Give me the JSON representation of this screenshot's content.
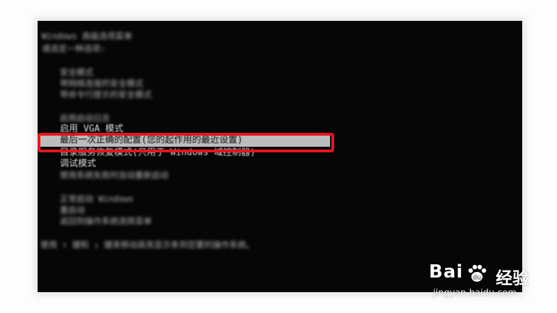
{
  "boot_menu": {
    "header_lines": [
      "Windows 高级选项菜单",
      "请选定一种选项:"
    ],
    "group1": [
      "安全模式",
      "带网络连接的安全模式",
      "带命令行提示的安全模式"
    ],
    "group2": [
      "启用启动日志",
      "启用 VGA 模式",
      "最后一次正确的配置(您的起作用的最近设置)",
      "目录服务恢复模式(只用于 Windows 域控制器)",
      "调试模式",
      "禁用系统失败时自动重新启动"
    ],
    "group3": [
      "正常启动 Windows",
      "重启动",
      "返回到操作系统选择菜单"
    ],
    "footer": "使用 ↑ 键和 ↓ 键来移动高亮显示条到您要的操作系统。"
  },
  "annotation": {
    "highlight_color": "#e8141d"
  },
  "watermark": {
    "brand": "Bai",
    "suffix": "经验",
    "url": "jingyan.baidu.com"
  }
}
